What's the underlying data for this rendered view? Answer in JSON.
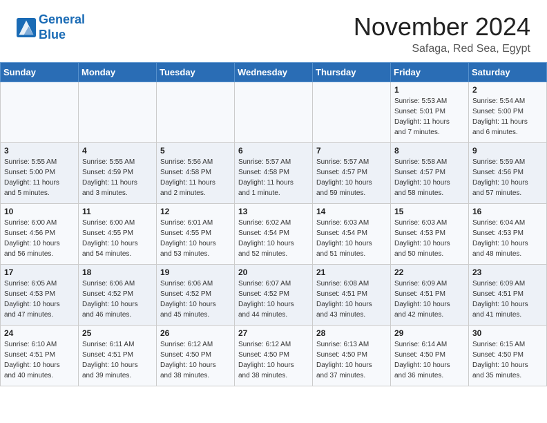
{
  "header": {
    "logo_line1": "General",
    "logo_line2": "Blue",
    "month": "November 2024",
    "location": "Safaga, Red Sea, Egypt"
  },
  "weekdays": [
    "Sunday",
    "Monday",
    "Tuesday",
    "Wednesday",
    "Thursday",
    "Friday",
    "Saturday"
  ],
  "weeks": [
    [
      {
        "day": "",
        "info": ""
      },
      {
        "day": "",
        "info": ""
      },
      {
        "day": "",
        "info": ""
      },
      {
        "day": "",
        "info": ""
      },
      {
        "day": "",
        "info": ""
      },
      {
        "day": "1",
        "info": "Sunrise: 5:53 AM\nSunset: 5:01 PM\nDaylight: 11 hours\nand 7 minutes."
      },
      {
        "day": "2",
        "info": "Sunrise: 5:54 AM\nSunset: 5:00 PM\nDaylight: 11 hours\nand 6 minutes."
      }
    ],
    [
      {
        "day": "3",
        "info": "Sunrise: 5:55 AM\nSunset: 5:00 PM\nDaylight: 11 hours\nand 5 minutes."
      },
      {
        "day": "4",
        "info": "Sunrise: 5:55 AM\nSunset: 4:59 PM\nDaylight: 11 hours\nand 3 minutes."
      },
      {
        "day": "5",
        "info": "Sunrise: 5:56 AM\nSunset: 4:58 PM\nDaylight: 11 hours\nand 2 minutes."
      },
      {
        "day": "6",
        "info": "Sunrise: 5:57 AM\nSunset: 4:58 PM\nDaylight: 11 hours\nand 1 minute."
      },
      {
        "day": "7",
        "info": "Sunrise: 5:57 AM\nSunset: 4:57 PM\nDaylight: 10 hours\nand 59 minutes."
      },
      {
        "day": "8",
        "info": "Sunrise: 5:58 AM\nSunset: 4:57 PM\nDaylight: 10 hours\nand 58 minutes."
      },
      {
        "day": "9",
        "info": "Sunrise: 5:59 AM\nSunset: 4:56 PM\nDaylight: 10 hours\nand 57 minutes."
      }
    ],
    [
      {
        "day": "10",
        "info": "Sunrise: 6:00 AM\nSunset: 4:56 PM\nDaylight: 10 hours\nand 56 minutes."
      },
      {
        "day": "11",
        "info": "Sunrise: 6:00 AM\nSunset: 4:55 PM\nDaylight: 10 hours\nand 54 minutes."
      },
      {
        "day": "12",
        "info": "Sunrise: 6:01 AM\nSunset: 4:55 PM\nDaylight: 10 hours\nand 53 minutes."
      },
      {
        "day": "13",
        "info": "Sunrise: 6:02 AM\nSunset: 4:54 PM\nDaylight: 10 hours\nand 52 minutes."
      },
      {
        "day": "14",
        "info": "Sunrise: 6:03 AM\nSunset: 4:54 PM\nDaylight: 10 hours\nand 51 minutes."
      },
      {
        "day": "15",
        "info": "Sunrise: 6:03 AM\nSunset: 4:53 PM\nDaylight: 10 hours\nand 50 minutes."
      },
      {
        "day": "16",
        "info": "Sunrise: 6:04 AM\nSunset: 4:53 PM\nDaylight: 10 hours\nand 48 minutes."
      }
    ],
    [
      {
        "day": "17",
        "info": "Sunrise: 6:05 AM\nSunset: 4:53 PM\nDaylight: 10 hours\nand 47 minutes."
      },
      {
        "day": "18",
        "info": "Sunrise: 6:06 AM\nSunset: 4:52 PM\nDaylight: 10 hours\nand 46 minutes."
      },
      {
        "day": "19",
        "info": "Sunrise: 6:06 AM\nSunset: 4:52 PM\nDaylight: 10 hours\nand 45 minutes."
      },
      {
        "day": "20",
        "info": "Sunrise: 6:07 AM\nSunset: 4:52 PM\nDaylight: 10 hours\nand 44 minutes."
      },
      {
        "day": "21",
        "info": "Sunrise: 6:08 AM\nSunset: 4:51 PM\nDaylight: 10 hours\nand 43 minutes."
      },
      {
        "day": "22",
        "info": "Sunrise: 6:09 AM\nSunset: 4:51 PM\nDaylight: 10 hours\nand 42 minutes."
      },
      {
        "day": "23",
        "info": "Sunrise: 6:09 AM\nSunset: 4:51 PM\nDaylight: 10 hours\nand 41 minutes."
      }
    ],
    [
      {
        "day": "24",
        "info": "Sunrise: 6:10 AM\nSunset: 4:51 PM\nDaylight: 10 hours\nand 40 minutes."
      },
      {
        "day": "25",
        "info": "Sunrise: 6:11 AM\nSunset: 4:51 PM\nDaylight: 10 hours\nand 39 minutes."
      },
      {
        "day": "26",
        "info": "Sunrise: 6:12 AM\nSunset: 4:50 PM\nDaylight: 10 hours\nand 38 minutes."
      },
      {
        "day": "27",
        "info": "Sunrise: 6:12 AM\nSunset: 4:50 PM\nDaylight: 10 hours\nand 38 minutes."
      },
      {
        "day": "28",
        "info": "Sunrise: 6:13 AM\nSunset: 4:50 PM\nDaylight: 10 hours\nand 37 minutes."
      },
      {
        "day": "29",
        "info": "Sunrise: 6:14 AM\nSunset: 4:50 PM\nDaylight: 10 hours\nand 36 minutes."
      },
      {
        "day": "30",
        "info": "Sunrise: 6:15 AM\nSunset: 4:50 PM\nDaylight: 10 hours\nand 35 minutes."
      }
    ]
  ]
}
